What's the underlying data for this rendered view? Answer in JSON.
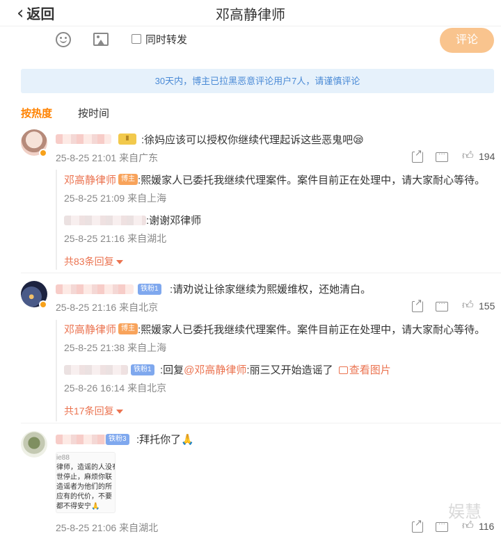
{
  "header": {
    "back_label": "返回",
    "title": "邓高静律师"
  },
  "composer": {
    "repost_label": "同时转发",
    "post_label": "评论"
  },
  "notice": "30天内，博主已拉黑恶意评论用户7人，请谨慎评论",
  "sort": {
    "hot": "按热度",
    "time": "按时间"
  },
  "comments": [
    {
      "badge": "Ⅱ",
      "text": ":徐妈应该可以授权你继续代理起诉这些恶鬼吧😪",
      "meta": "25-8-25 21:01 来自广东",
      "likes": "194",
      "replies": [
        {
          "name": "邓高静律师",
          "badge": "博主",
          "text": ":熙媛家人已委托我继续代理案件。案件目前正在处理中，请大家耐心等待。",
          "meta": "25-8-25 21:09 来自上海"
        },
        {
          "text": ":谢谢邓律师",
          "meta": "25-8-25 21:16 来自湖北"
        }
      ],
      "more": "共83条回复"
    },
    {
      "badge": "铁粉1",
      "text": ":请劝说让徐家继续为熙媛维权，还她清白。",
      "meta": "25-8-25 21:16 来自北京",
      "likes": "155",
      "replies": [
        {
          "name": "邓高静律师",
          "badge": "博主",
          "text": ":熙媛家人已委托我继续代理案件。案件目前正在处理中，请大家耐心等待。",
          "meta": "25-8-25 21:38 来自上海"
        },
        {
          "badge": "铁粉1",
          "prefix": ":回复",
          "mention": "@邓高静律师",
          "text": ":丽三又开始造谣了",
          "image_link": "查看图片",
          "meta": "25-8-26 16:14 来自北京"
        }
      ],
      "more": "共17条回复"
    },
    {
      "badge": "铁粉3",
      "text": ":拜托你了🙏",
      "meta": "25-8-25 21:06 来自湖北",
      "likes": "116",
      "image_lines": [
        "ie88",
        "律师，造谣的人没有",
        "世停止，麻烦你联",
        "造谣者为他们的所",
        "应有的代价，不要",
        "都不得安宁🙏"
      ]
    }
  ],
  "watermark": "娱慧",
  "icons": [
    "back-chevron-icon",
    "emoji-icon",
    "image-icon",
    "share-icon",
    "comment-icon",
    "like-icon"
  ],
  "colors": {
    "accent": "#ff8200",
    "name": "#eb7350",
    "notice_bg": "#e6f1fb",
    "notice_text": "#4a8ad6",
    "post_button": "#f9c48e"
  }
}
